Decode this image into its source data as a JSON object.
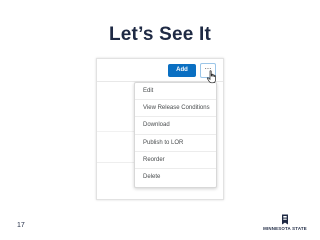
{
  "slide": {
    "title": "Let’s See It",
    "page_number": "17"
  },
  "toolbar": {
    "add_label": "Add",
    "more_label": "···"
  },
  "menu": {
    "items": [
      {
        "label": "Edit"
      },
      {
        "label": "View Release Conditions"
      },
      {
        "label": "Download"
      },
      {
        "label": "Publish to LOR"
      },
      {
        "label": "Reorder"
      },
      {
        "label": "Delete"
      }
    ]
  },
  "logo": {
    "text": "MINNESOTA STATE"
  },
  "colors": {
    "accent": "#0a6fc2",
    "title": "#1f2a44"
  },
  "icons": {
    "cursor": "hand-pointer-icon",
    "logo_mark": "minnesota-state-logo-icon"
  }
}
